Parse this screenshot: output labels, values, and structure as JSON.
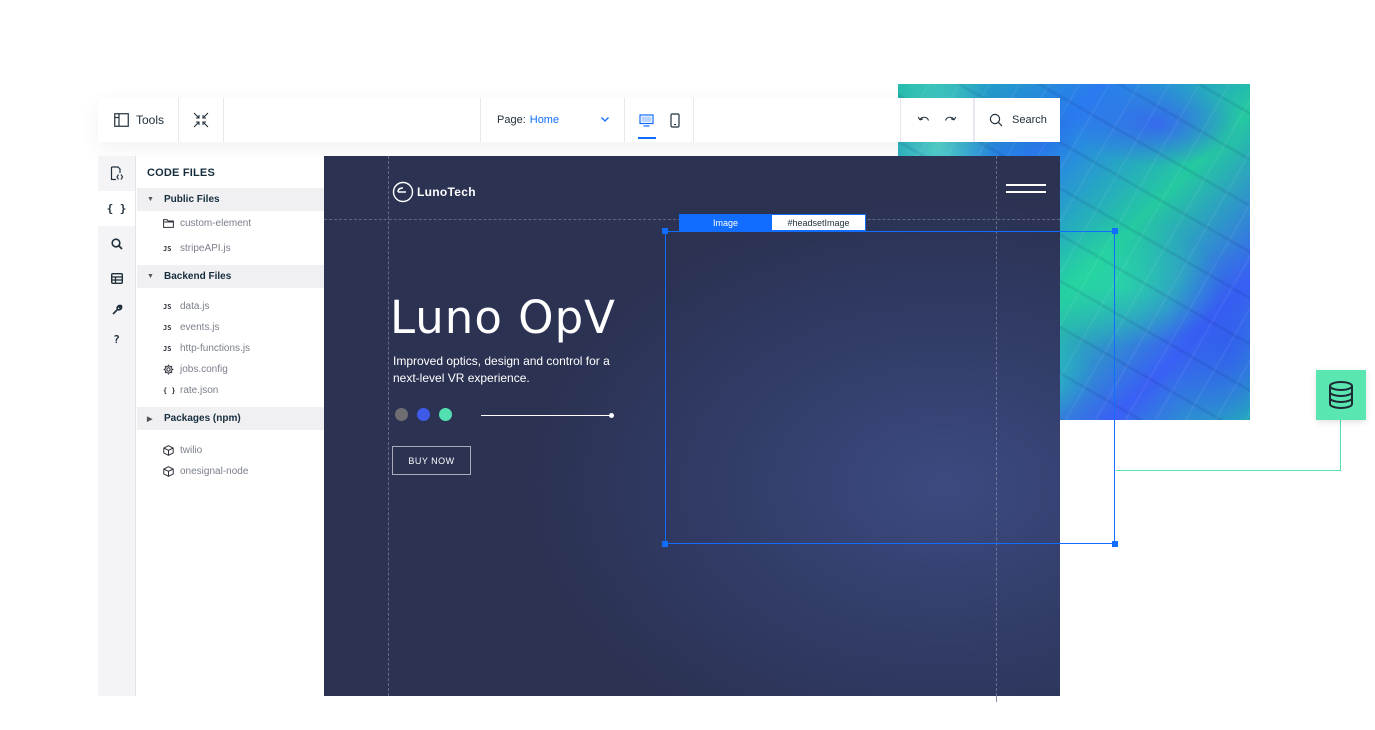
{
  "toolbar": {
    "tools_label": "Tools",
    "page_label": "Page:",
    "page_value": "Home",
    "search_label": "Search"
  },
  "rail": {
    "icons": [
      "page-code-icon",
      "code-braces-icon",
      "search-icon",
      "database-icon",
      "wrench-icon",
      "help-icon"
    ],
    "braces_text": "{ }",
    "help_text": "?"
  },
  "tree": {
    "title": "CODE FILES",
    "sections": [
      {
        "label": "Public Files",
        "expanded": true,
        "files": [
          {
            "icon": "folder-icon",
            "name": "custom-element"
          },
          {
            "icon": "JS",
            "name": "stripeAPI.js"
          }
        ]
      },
      {
        "label": "Backend Files",
        "expanded": true,
        "files": [
          {
            "icon": "JS",
            "name": "data.js"
          },
          {
            "icon": "JS",
            "name": "events.js"
          },
          {
            "icon": "JS",
            "name": "http-functions.js"
          },
          {
            "icon": "gear-icon",
            "name": "jobs.config"
          },
          {
            "icon": "{ }",
            "name": "rate.json"
          }
        ]
      },
      {
        "label": "Packages (npm)",
        "expanded": false,
        "files": [
          {
            "icon": "package-icon",
            "name": "twilio"
          },
          {
            "icon": "package-icon",
            "name": "onesignal-node"
          }
        ]
      }
    ]
  },
  "canvas": {
    "logo_text": "LunoTech",
    "hero_title": "Luno OpV",
    "hero_subtitle": "Improved optics, design and control for a next-level VR experience.",
    "dot_colors": [
      "#6e6e72",
      "#3d5ae8",
      "#53e0b0"
    ],
    "buy_button": "BUY NOW"
  },
  "selection": {
    "type_tag": "Image",
    "id_tag": "#headsetImage"
  },
  "colors": {
    "accent": "#116dff",
    "connector": "#5ae6b0"
  }
}
